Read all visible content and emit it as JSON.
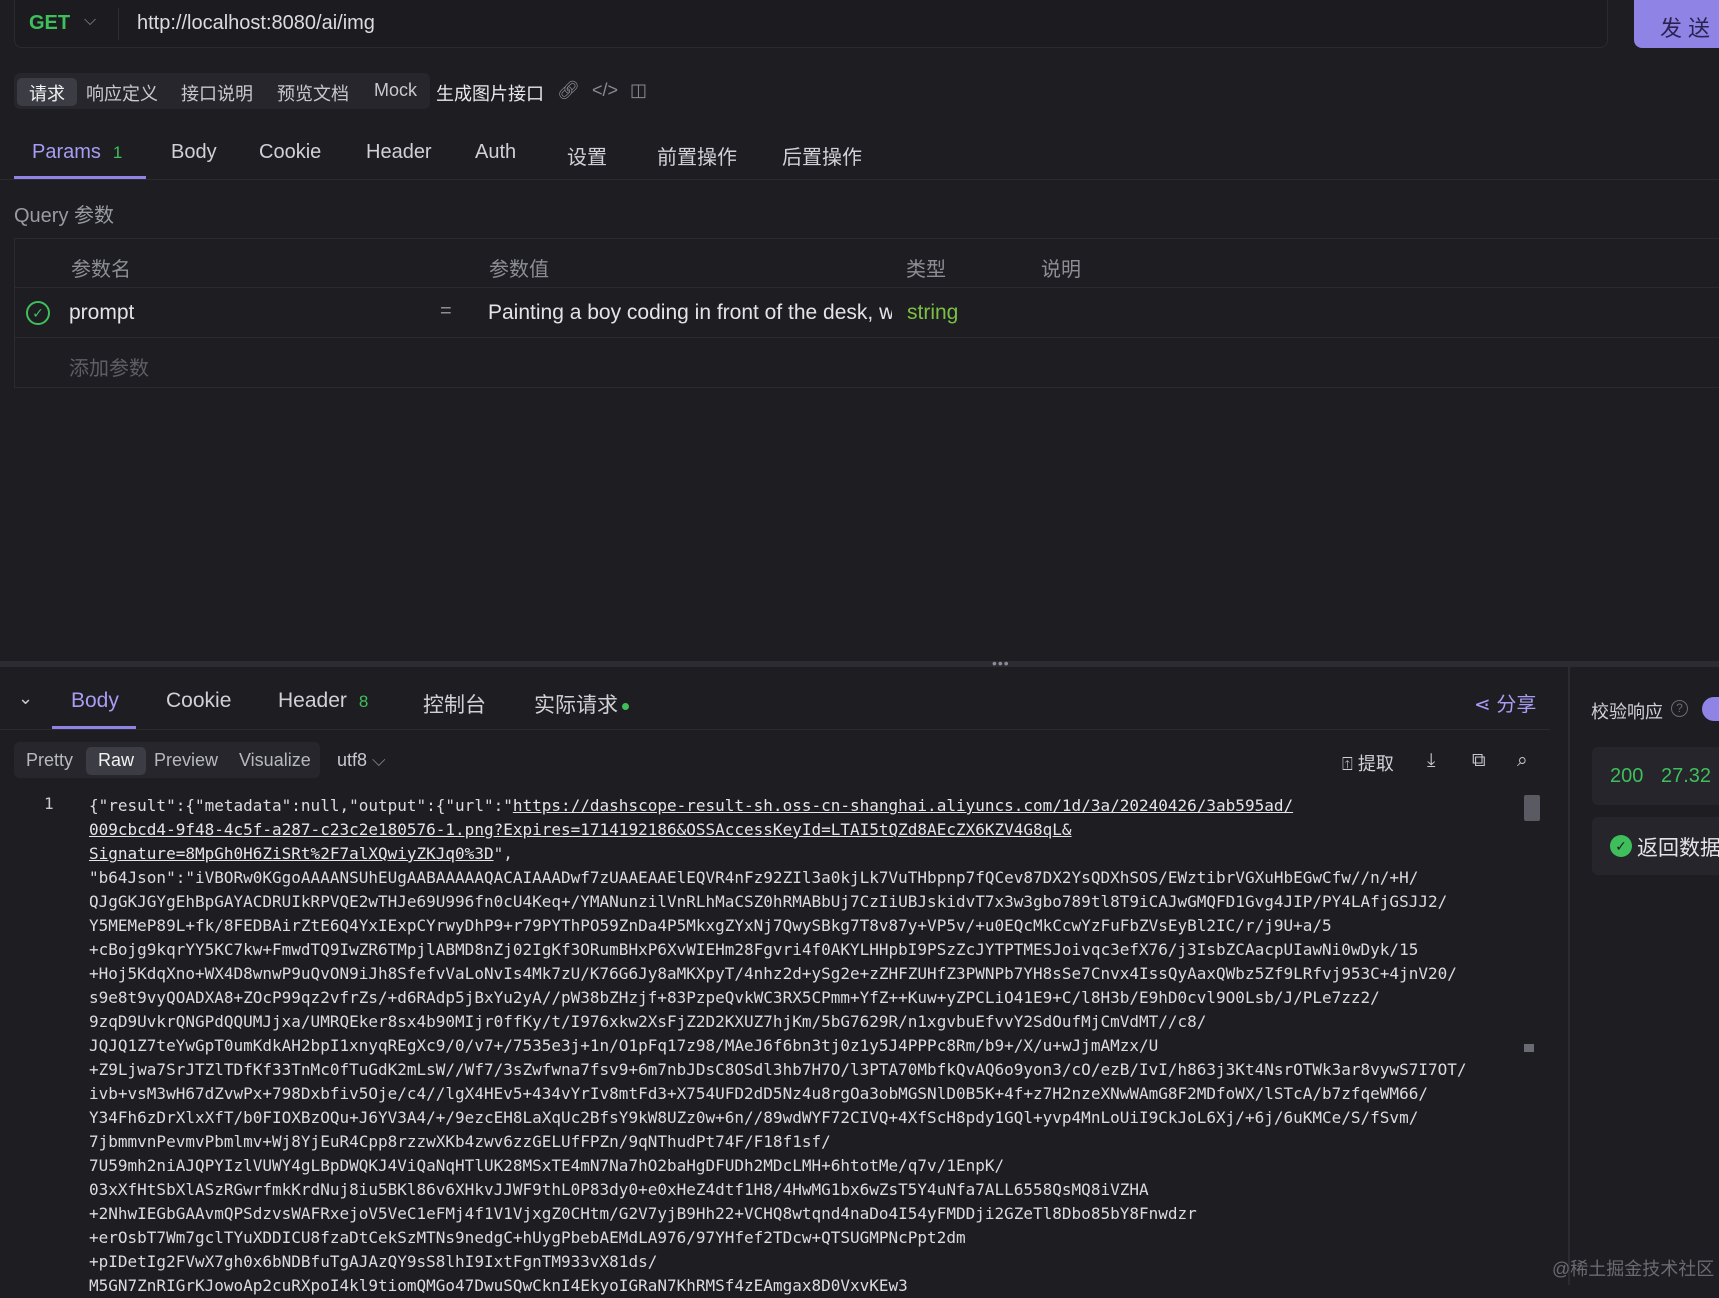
{
  "request": {
    "method": "GET",
    "url": "http://localhost:8080/ai/img",
    "send_label": "发送"
  },
  "doc_tabs": [
    {
      "label": "请求",
      "active": true
    },
    {
      "label": "响应定义"
    },
    {
      "label": "接口说明"
    },
    {
      "label": "预览文档"
    },
    {
      "label": "Mock"
    }
  ],
  "api_name": "生成图片接口",
  "request_tabs": [
    {
      "label": "Params",
      "count": "1",
      "active": true
    },
    {
      "label": "Body"
    },
    {
      "label": "Cookie"
    },
    {
      "label": "Header"
    },
    {
      "label": "Auth"
    },
    {
      "label": "设置"
    },
    {
      "label": "前置操作"
    },
    {
      "label": "后置操作"
    }
  ],
  "query_label": "Query 参数",
  "params_table": {
    "headers": [
      "参数名",
      "参数值",
      "类型",
      "说明"
    ],
    "rows": [
      {
        "name": "prompt",
        "eq": "=",
        "value": "Painting a boy coding in front of the desk, w",
        "type": "string",
        "enabled": true
      }
    ],
    "add_placeholder": "添加参数"
  },
  "response_tabs": [
    {
      "label": "Body",
      "active": true
    },
    {
      "label": "Cookie"
    },
    {
      "label": "Header",
      "count": "8"
    },
    {
      "label": "控制台"
    },
    {
      "label": "实际请求",
      "dot": true
    }
  ],
  "share_label": "分享",
  "format_tabs": [
    {
      "label": "Pretty"
    },
    {
      "label": "Raw",
      "active": true
    },
    {
      "label": "Preview"
    },
    {
      "label": "Visualize"
    }
  ],
  "encoding": "utf8",
  "extract_label": "提取",
  "code": {
    "line_number": "1",
    "lines": [
      "{\"result\":{\"metadata\":null,\"output\":{\"url\":\"https://dashscope-result-sh.oss-cn-shanghai.aliyuncs.com/1d/3a/20240426/3ab595ad/",
      "009cbcd4-9f48-4c5f-a287-c23c2e180576-1.png?Expires=1714192186&OSSAccessKeyId=LTAI5tQZd8AEcZX6KZV4G8qL&",
      "Signature=8MpGh0H6ZiSRt%2F7alXQwiyZKJq0%3D\",",
      "\"b64Json\":\"iVBORw0KGgoAAAANSUhEUgAABAAAAAQACAIAAADwf7zUAAEAAElEQVR4nFz92ZIl3a0kjLk7VuTHbpnp7fQCev87DX2YsQDXhSOS/EWztibrVGXuHbEGwCfw//n/+H/",
      "QJgGKJGYgEhBpGAYACDRUIkRPVQE2wTHJe69U996fn0cU4Keq+/YMANunzilVnRLhMaCSZ0hRMABbUj7CzIiUBJskidvT7x3w3gbo789tl8T9iCAJwGMQFD1Gvg4JIP/PY4LAfjGSJJ2/",
      "Y5MEMeP89L+fk/8FEDBAirZtE6Q4YxIExpCYrwyDhP9+r79PYThPO59ZnDa4P5MkxgZYxNj7QwySBkg7T8v87y+VP5v/+u0EQcMkCcwYzFuFbZVsEyBl2IC/r/j9U+a/5",
      "+cBojg9kqrYY5KC7kw+FmwdTQ9IwZR6TMpjlABMD8nZj02IgKf3ORumBHxP6XvWIEHm28Fgvri4f0AKYLHHpbI9PSzZcJYTPTMESJoivqc3efX76/j3IsbZCAacpUIawNi0wDyk/15",
      "+Hoj5KdqXno+WX4D8wnwP9uQvON9iJh8SfefvVaLoNvIs4Mk7zU/K76G6Jy8aMKXpyT/4nhz2d+ySg2e+zZHFZUHfZ3PWNPb7YH8sSe7Cnvx4IssQyAaxQWbz5Zf9LRfvj953C+4jnV20/",
      "s9e8t9vyQOADXA8+ZOcP99qz2vfrZs/+d6RAdp5jBxYu2yA//pW38bZHzjf+83PzpeQvkWC3RX5CPmm+YfZ++Kuw+yZPCLiO41E9+C/l8H3b/E9hD0cvl9O0Lsb/J/PLe7zz2/",
      "9zqD9UvkrQNGPdQQUMJjxa/UMRQEker8sx4b90MIjr0ffKy/t/I976xkw2XsFjZ2D2KXUZ7hjKm/5bG7629R/n1xgvbuEfvvY2SdOufMjCmVdMT//c8/",
      "JQJQ1Z7teYwGpT0umKdkAH2bpI1xnyqREgXc9/0/v7+/7535e3j+1n/O1pFq17z98/MAeJ6f6bn3tj0z1y5J4PPPc8Rm/b9+/X/u+wJjmAMzx/U",
      "+Z9Ljwa7SrJTZlTDfKf33TnMc0fTuGdK2mLsW//Wf7/3sZwfwna7fsv9+6m7nbJDsC8OSdl3hb7H7O/l3PTA70MbfkQvAQ6o9yon3/cO/ezB/IvI/h863j3Kt4NsrOTWk3ar8vywS7I7OT/",
      "ivb+vsM3wH67dZvwPx+798Dxbfiv5Oje/c4//lgX4HEv5+434vYrIv8mtFd3+X754UFD2dD5Nz4u8rgOa3obMGSNlD0B5K+4f+z7H2nzeXNwWAmG8F2MDfoWX/lSTcA/b7zfqeWM66/",
      "Y34Fh6zDrXlxXfT/b0FIOXBzOQu+J6YV3A4/+/9ezcEH8LaXqUc2BfsY9kW8UZz0w+6n//89wdWYF72CIVQ+4XfScH8pdy1GQl+yvp4MnLoUiI9CkJoL6Xj/+6j/6uKMCe/S/fSvm/",
      "7jbmmvnPevmvPbmlmv+Wj8YjEuR4Cpp8rzzwXKb4zwv6zzGELUfFPZn/9qNThudPt74F/F18f1sf/",
      "7U59mh2niAJQPYIzlVUWY4gLBpDWQKJ4ViQaNqHTlUK28MSxTE4mN7Na7hO2baHgDFUDh2MDcLMH+6htotMe/q7v/1EnpK/",
      "03xXfHtSbXlASzRGwrfmkKrdNuj8iu5BKl86v6XHkvJJWF9thL0P83dy0+e0xHeZ4dtf1H8/4HwMG1bx6wZsT5Y4uNfa7ALL6558QsMQ8iVZHA",
      "+2NhwIEGbGAAvmQPSdzvsWAFRxejoV5VeC1eFMj4f1V1VjxgZ0CHtm/G2V7yjB9Hh22+VCHQ8wtqnd4naDo4I54yFMDDji2GZeTl8Dbo85bY8Fnwdzr",
      "+erOsbT7Wm7gclTYuXDDICU8fzaDtCekSzMTNs9nedgC+hUygPbebAEMdLA976/97YHfef2TDcw+QTSUGMPNcPpt2dm",
      "+pIDetIg2FVwX7gh0x6bNDBfuTgAJAzQY9sS8lhI9IxtFgnTM933vX81ds/",
      "M5GN7ZnRIGrKJowoAp2cuRXpoI4kl9tiomQMGo47DwuSQwCknI4EkyoIGRaN7KhRMSf4zEAmgax8D0VxvKEw3"
    ]
  },
  "sidebar": {
    "verify_label": "校验响应",
    "status_code": "200",
    "time": "27.32",
    "return_label": "返回数据"
  },
  "watermark": "@稀土掘金技术社区"
}
